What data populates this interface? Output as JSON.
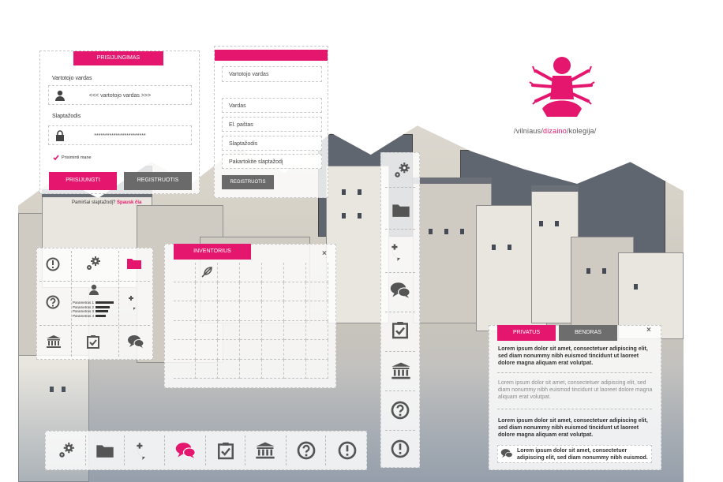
{
  "colors": {
    "accent": "#e5166e",
    "dark_button": "#6a6a6a",
    "icon": "#555555"
  },
  "login": {
    "tab": "PRISIJUNGIMAS",
    "username_label": "Vartotojo vardas",
    "username_placeholder": "<<< vartotojo vardas >>>",
    "password_label": "Slaptažodis",
    "password_value": "************************",
    "remember_label": "Prisiminti mane",
    "login_button": "PRISIJUNGTI",
    "register_button": "REGISTRUOTIS",
    "forgot_text": "Pamiršai slaptažodį?",
    "forgot_link": "Spausk čia"
  },
  "register": {
    "username": "Vartotojo vardas",
    "name": "Vardas",
    "email": "El. paštas",
    "password": "Slaptažodis",
    "repeat_password": "Pakartokite slaptažodį",
    "submit": "REGISTRUOTIS"
  },
  "logo": {
    "part1": "/vilniaus/",
    "part2": "dizaino",
    "part3": "/kolegija/"
  },
  "stats": {
    "rows": [
      {
        "label": "Parametras 1",
        "value": 0.9
      },
      {
        "label": "Parametras 2",
        "value": 0.7
      },
      {
        "label": "Parametras 3",
        "value": 0.6
      },
      {
        "label": "Parametras 4",
        "value": 0.5
      }
    ]
  },
  "inventory": {
    "tab": "INVENTORIUS",
    "close": "×"
  },
  "messages": {
    "tab_private": "PRIVATUS",
    "tab_common": "BENDRAS",
    "close": "×",
    "items": [
      "Lorem ipsum dolor sit amet, consectetuer adipiscing elit, sed diam nonummy nibh euismod tincidunt ut laoreet dolore magna aliquam erat volutpat.",
      "Lorem ipsum dolor sit amet, consectetuer adipiscing elit, sed diam nonummy nibh euismod tincidunt ut laoreet dolore magna aliquam erat volutpat.",
      "Lorem ipsum dolor sit amet, consectetuer adipiscing elit, sed diam nonummy nibh euismod tincidunt ut laoreet dolore magna aliquam erat volutpat."
    ],
    "input_text": "Lorem ipsum dolor sit amet, consectetuer adipiscing elit, sed diam nonummy nibh euismod."
  }
}
